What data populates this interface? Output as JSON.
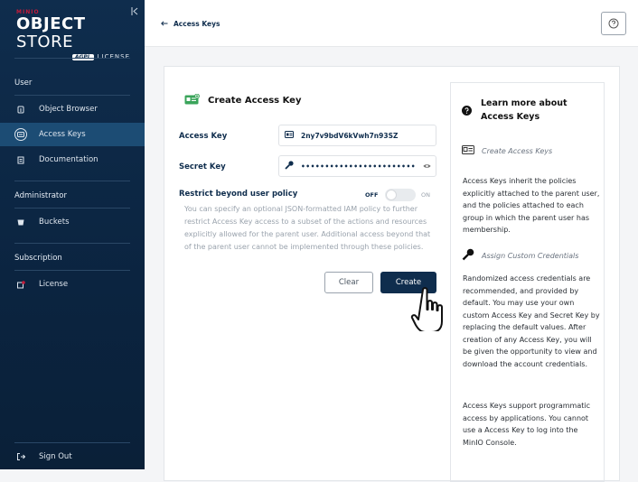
{
  "brand": {
    "small": "MINIO",
    "title_bold": "OBJECT",
    "title_rest": "STORE",
    "badge": "AGPL",
    "license": "LICENSE"
  },
  "sidebar": {
    "sections": {
      "user": "User",
      "administrator": "Administrator",
      "subscription": "Subscription"
    },
    "items": {
      "object_browser": "Object Browser",
      "access_keys": "Access Keys",
      "documentation": "Documentation",
      "buckets": "Buckets",
      "license": "License",
      "sign_out": "Sign Out"
    },
    "active": "access_keys"
  },
  "header": {
    "back_label": "Access Keys"
  },
  "form": {
    "title": "Create Access Key",
    "access_key_label": "Access Key",
    "access_key_value": "2ny7v9bdV6kVwh7n93SZ",
    "secret_key_label": "Secret Key",
    "secret_key_value": "••••••••••••••••••••••••",
    "restrict_label": "Restrict beyond user policy",
    "toggle_off": "OFF",
    "toggle_on": "ON",
    "restrict_enabled": false,
    "restrict_description": "You can specify an optional JSON-formatted IAM policy to further restrict Access Key access to a subset of the actions and resources explicitly allowed for the parent user. Additional access beyond that of the parent user cannot be implemented through these policies.",
    "clear_label": "Clear",
    "create_label": "Create"
  },
  "help": {
    "title": "Learn more about Access Keys",
    "create_heading": "Create Access Keys",
    "create_text": "Access Keys inherit the policies explicitly attached to the parent user, and the policies attached to each group in which the parent user has membership.",
    "custom_heading": "Assign Custom Credentials",
    "custom_text": "Randomized access credentials are recommended, and provided by default. You may use your own custom Access Key and Secret Key by replacing the default values. After creation of any Access Key, you will be given the opportunity to view and download the account credentials.",
    "support_text": "Access Keys support programmatic access by applications. You cannot use a Access Key to log into the MinIO Console."
  },
  "colors": {
    "sidebar_bg": "#0f2d4d",
    "active_item": "#1c4c74",
    "primary": "#0f2d4d",
    "brand_red": "#c51b3a"
  }
}
